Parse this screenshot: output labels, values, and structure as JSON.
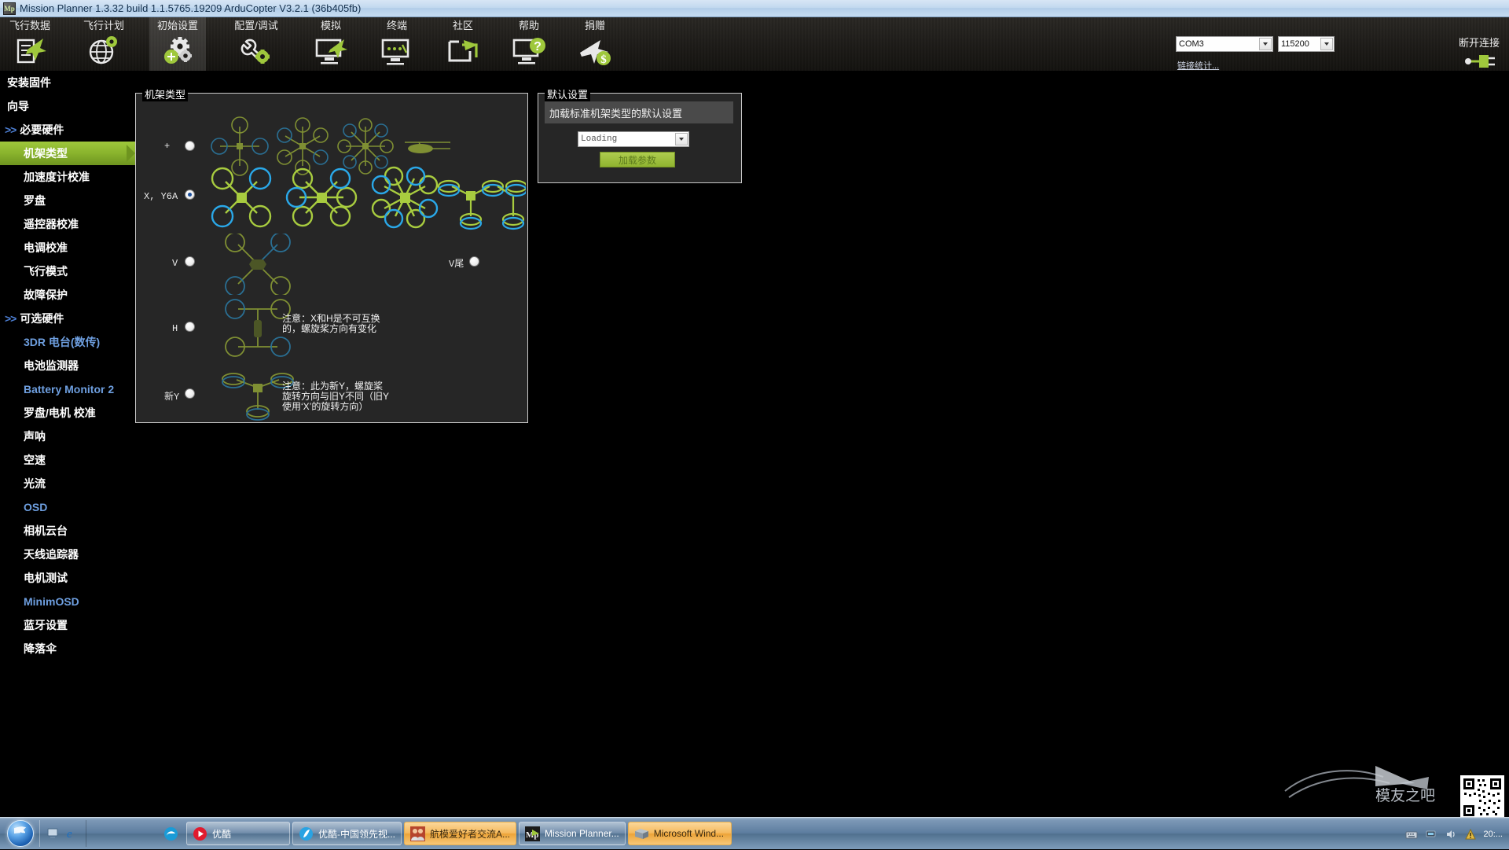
{
  "window": {
    "title": "Mission Planner 1.3.32 build 1.1.5765.19209 ArduCopter V3.2.1 (36b405fb)",
    "icon_text": "Mp"
  },
  "menubar": {
    "items": [
      {
        "label": "飞行数据",
        "icon": "flight-data-icon",
        "active": false
      },
      {
        "label": "飞行计划",
        "icon": "flight-plan-icon",
        "active": false
      },
      {
        "label": "初始设置",
        "icon": "initial-setup-icon",
        "active": true
      },
      {
        "label": "配置/调试",
        "icon": "config-tuning-icon",
        "active": false
      },
      {
        "label": "模拟",
        "icon": "simulation-icon",
        "active": false
      },
      {
        "label": "终端",
        "icon": "terminal-icon",
        "active": false
      },
      {
        "label": "社区",
        "icon": "community-icon",
        "active": false
      },
      {
        "label": "帮助",
        "icon": "help-icon",
        "active": false
      },
      {
        "label": "捐赠",
        "icon": "donate-icon",
        "active": false
      }
    ]
  },
  "connection": {
    "port_value": "COM3",
    "baud_value": "115200",
    "link_stats_label": "链接统计...",
    "connect_label": "断开连接",
    "connect_icon": "plug-icon"
  },
  "sidebar": {
    "items": [
      {
        "label": "安装固件",
        "level": 0,
        "style": "plain",
        "selected": false
      },
      {
        "label": "向导",
        "level": 0,
        "style": "plain",
        "selected": false
      },
      {
        "label": "必要硬件",
        "level": 0,
        "style": "group",
        "chev": ">>",
        "selected": false
      },
      {
        "label": "机架类型",
        "level": 1,
        "style": "plain",
        "selected": true
      },
      {
        "label": "加速度计校准",
        "level": 1,
        "style": "plain",
        "selected": false
      },
      {
        "label": "罗盘",
        "level": 1,
        "style": "plain",
        "selected": false
      },
      {
        "label": "遥控器校准",
        "level": 1,
        "style": "plain",
        "selected": false
      },
      {
        "label": "电调校准",
        "level": 1,
        "style": "plain",
        "selected": false
      },
      {
        "label": "飞行模式",
        "level": 1,
        "style": "plain",
        "selected": false
      },
      {
        "label": "故障保护",
        "level": 1,
        "style": "plain",
        "selected": false
      },
      {
        "label": "可选硬件",
        "level": 0,
        "style": "group",
        "chev": ">>",
        "selected": false
      },
      {
        "label": "3DR 电台(数传)",
        "level": 1,
        "style": "accent",
        "selected": false
      },
      {
        "label": "电池监测器",
        "level": 1,
        "style": "plain",
        "selected": false
      },
      {
        "label": "Battery Monitor 2",
        "level": 1,
        "style": "accent",
        "selected": false
      },
      {
        "label": "罗盘/电机 校准",
        "level": 1,
        "style": "plain",
        "selected": false
      },
      {
        "label": "声呐",
        "level": 1,
        "style": "plain",
        "selected": false
      },
      {
        "label": "空速",
        "level": 1,
        "style": "plain",
        "selected": false
      },
      {
        "label": "光流",
        "level": 1,
        "style": "plain",
        "selected": false
      },
      {
        "label": "OSD",
        "level": 1,
        "style": "accent",
        "selected": false
      },
      {
        "label": "相机云台",
        "level": 1,
        "style": "plain",
        "selected": false
      },
      {
        "label": "天线追踪器",
        "level": 1,
        "style": "plain",
        "selected": false
      },
      {
        "label": "电机测试",
        "level": 1,
        "style": "plain",
        "selected": false
      },
      {
        "label": "MinimOSD",
        "level": 1,
        "style": "accent",
        "selected": false
      },
      {
        "label": "蓝牙设置",
        "level": 1,
        "style": "plain",
        "selected": false
      },
      {
        "label": "降落伞",
        "level": 1,
        "style": "plain",
        "selected": false
      }
    ]
  },
  "frame_type": {
    "group_title": "机架类型",
    "rows": [
      {
        "id": "plus",
        "label": "+",
        "selected": false,
        "note": ""
      },
      {
        "id": "x",
        "label": "X, Y6A",
        "selected": true,
        "note": ""
      },
      {
        "id": "v",
        "label": "V",
        "selected": false,
        "note": ""
      },
      {
        "id": "h",
        "label": "H",
        "selected": false,
        "note": "注意：X和H是不可互换\n的，螺旋桨方向有变化"
      },
      {
        "id": "newy",
        "label": "新Y",
        "selected": false,
        "note": "注意：此为新Y，螺旋桨\n旋转方向与旧Y不同（旧Y\n使用‘X’的旋转方向）"
      }
    ],
    "vtail": {
      "label": "V尾",
      "selected": false
    }
  },
  "default_settings": {
    "group_title": "默认设置",
    "description": "加载标准机架类型的默认设置",
    "dropdown_value": "Loading",
    "button_label": "加载参数"
  },
  "taskbar": {
    "start_label": "start",
    "quick_launch": [
      "show-desktop-icon",
      "internet-explorer-icon"
    ],
    "buttons": [
      {
        "label": "",
        "icon": "edge-icon",
        "style": "plain",
        "iconOnly": true
      },
      {
        "label": "优酷",
        "icon": "youku-icon",
        "style": "plain"
      },
      {
        "label": "优酷-中国领先视...",
        "icon": "browser-icon",
        "style": "plain"
      },
      {
        "label": "航模爱好者交流A...",
        "icon": "people-icon",
        "style": "orange"
      },
      {
        "label": "Mission Planner...",
        "icon": "mission-planner-icon",
        "style": "plain"
      },
      {
        "label": "Microsoft Wind...",
        "icon": "windows-explorer-icon",
        "style": "orange"
      }
    ],
    "tray_icons": [
      "keyboard-icon",
      "network-icon",
      "volume-icon",
      "action-center-icon"
    ],
    "clock": "20:..."
  },
  "watermark": {
    "text": "模友之吧"
  },
  "colors": {
    "accent_green": "#9fc83c",
    "panel_bg": "#262626",
    "sidebar_bg": "#000000",
    "link_blue": "#6e9fe0"
  }
}
